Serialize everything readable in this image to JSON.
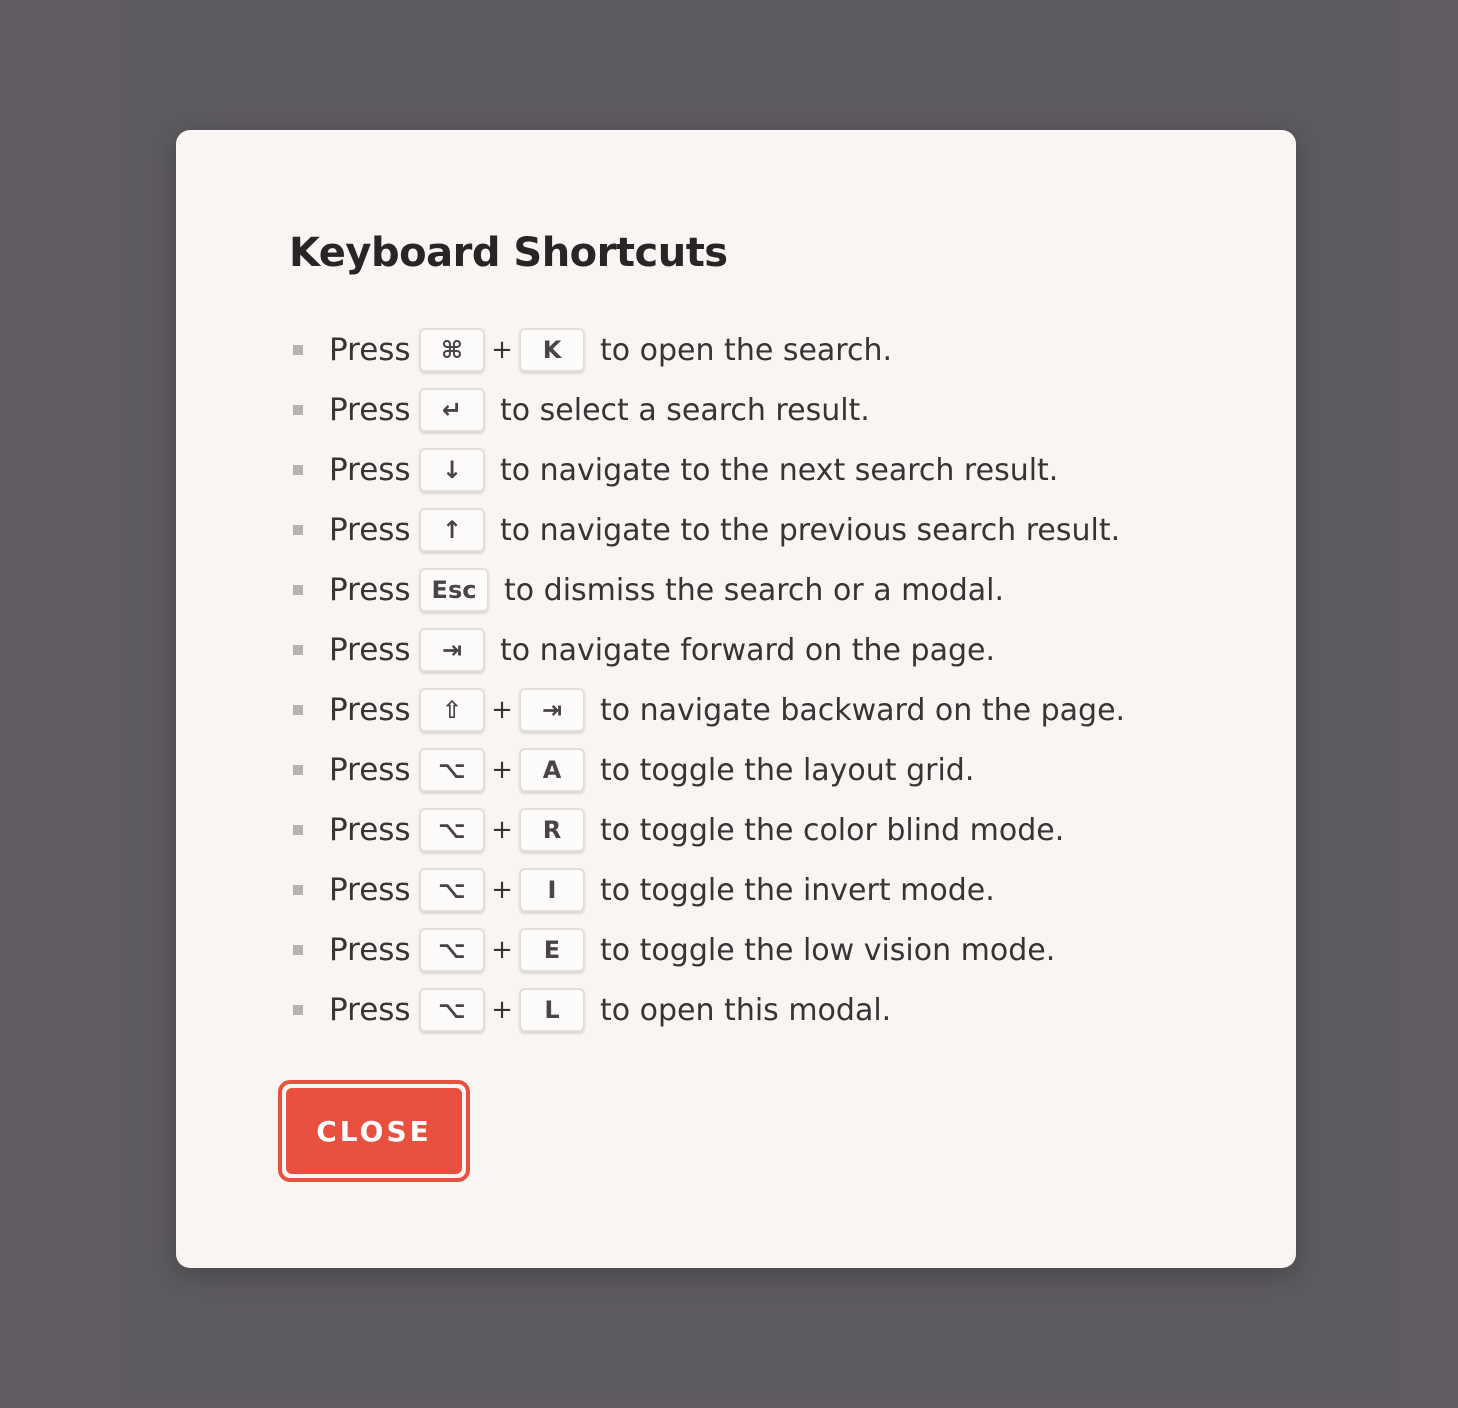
{
  "modal": {
    "title": "Keyboard Shortcuts",
    "close_label": "CLOSE",
    "shortcuts": [
      {
        "press": "Press",
        "keys": [
          "⌘",
          "K"
        ],
        "plus": "+",
        "description": "to open the search."
      },
      {
        "press": "Press",
        "keys": [
          "↵"
        ],
        "description": "to select a search result."
      },
      {
        "press": "Press",
        "keys": [
          "↓"
        ],
        "description": "to navigate to the next search result."
      },
      {
        "press": "Press",
        "keys": [
          "↑"
        ],
        "description": "to navigate to the previous search result."
      },
      {
        "press": "Press",
        "keys": [
          "Esc"
        ],
        "description": "to dismiss the search or a modal."
      },
      {
        "press": "Press",
        "keys": [
          "⇥"
        ],
        "description": "to navigate forward on the page."
      },
      {
        "press": "Press",
        "keys": [
          "⇧",
          "⇥"
        ],
        "plus": "+",
        "description": "to navigate backward on the page."
      },
      {
        "press": "Press",
        "keys": [
          "⌥",
          "A"
        ],
        "plus": "+",
        "description": "to toggle the layout grid."
      },
      {
        "press": "Press",
        "keys": [
          "⌥",
          "R"
        ],
        "plus": "+",
        "description": "to toggle the color blind mode."
      },
      {
        "press": "Press",
        "keys": [
          "⌥",
          "I"
        ],
        "plus": "+",
        "description": "to toggle the invert mode."
      },
      {
        "press": "Press",
        "keys": [
          "⌥",
          "E"
        ],
        "plus": "+",
        "description": "to toggle the low vision mode."
      },
      {
        "press": "Press",
        "keys": [
          "⌥",
          "L"
        ],
        "plus": "+",
        "description": "to open this modal."
      }
    ]
  },
  "colors": {
    "backdrop": "#5f5b60",
    "modal_bg": "#f9f5f2",
    "accent": "#e8513f",
    "text": "#3a3235"
  }
}
